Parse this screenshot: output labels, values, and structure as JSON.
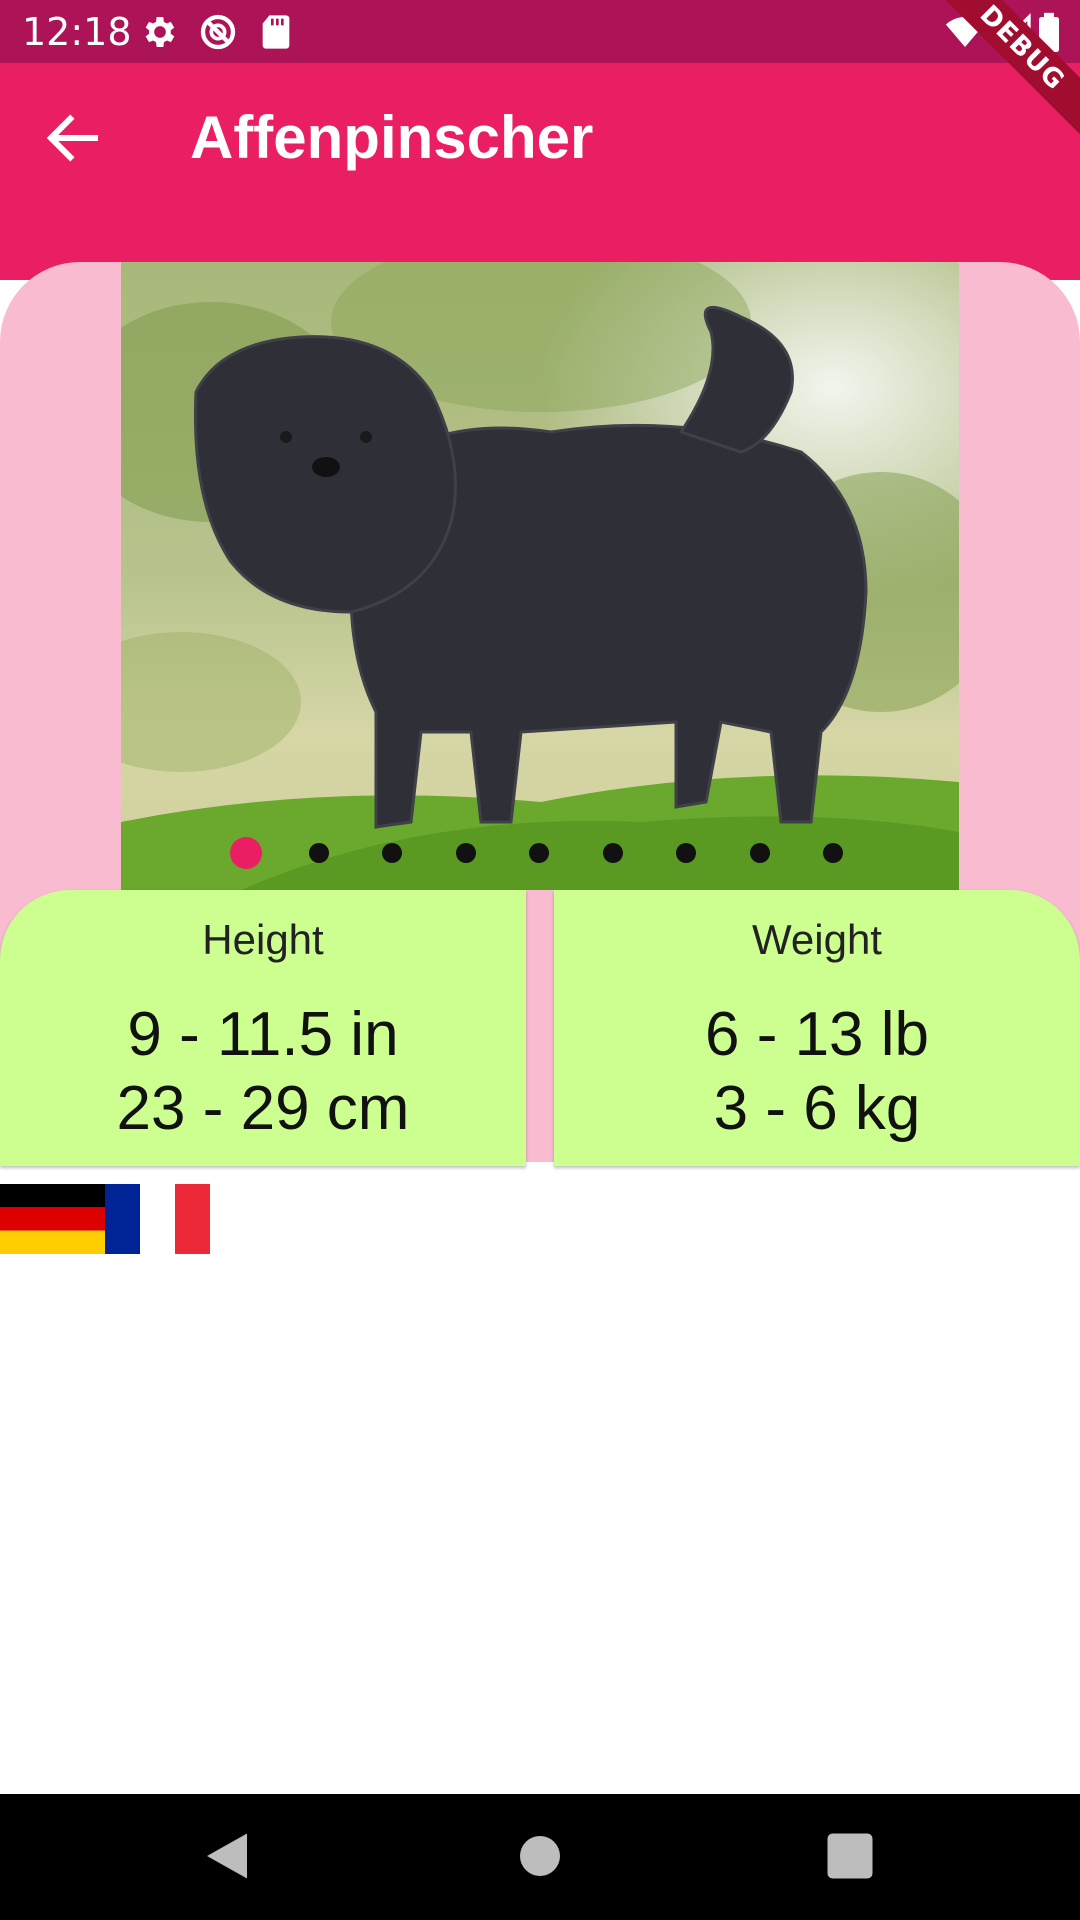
{
  "status_bar": {
    "time": "12:18",
    "icons": [
      "settings-icon",
      "no-entry-icon",
      "sd-card-icon",
      "wifi-icon",
      "signal-icon",
      "battery-icon"
    ],
    "debug_label": "DEBUG"
  },
  "app_bar": {
    "title": "Affenpinscher",
    "back_icon": "arrow-back-icon",
    "color": "#e91e63"
  },
  "carousel": {
    "image": "affenpinscher-photo",
    "page_count": 9,
    "active_index": 0,
    "active_dot_color": "#e91e63",
    "background": "#f8bbd0"
  },
  "stats": {
    "height": {
      "label": "Height",
      "imperial": "9 - 11.5 in",
      "metric": "23 - 29 cm"
    },
    "weight": {
      "label": "Weight",
      "imperial": "6 - 13 lb",
      "metric": "3 - 6 kg"
    },
    "card_color": "#ccff90"
  },
  "origin_flags": [
    "germany-flag",
    "france-flag"
  ],
  "nav_bar": {
    "buttons": [
      "back-triangle-icon",
      "home-circle-icon",
      "recents-square-icon"
    ]
  }
}
